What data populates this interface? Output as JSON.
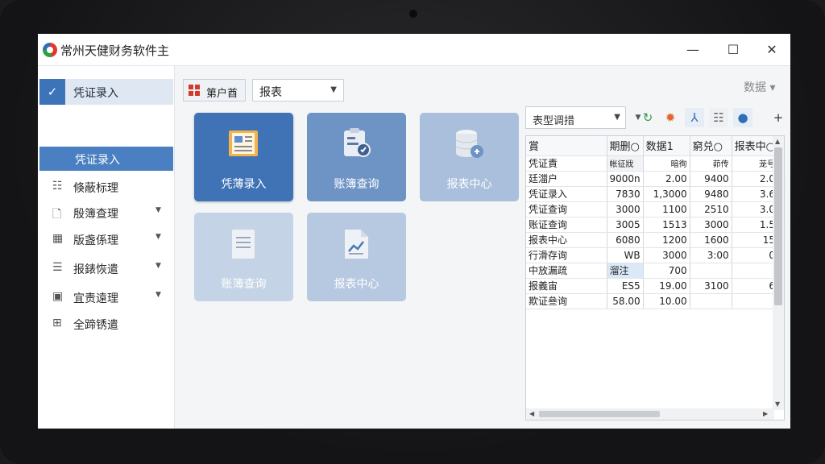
{
  "window": {
    "title": "常州天健财务软件主",
    "min": "—",
    "max": "☐",
    "close": "✕"
  },
  "sidebar": {
    "header": {
      "label": "凭证录入",
      "icon": "chart-check-icon"
    },
    "active": "凭证录入",
    "items": [
      {
        "label": "倏蔽标理",
        "icon": "list-icon",
        "arrow": false
      },
      {
        "label": "殷簿查理",
        "icon": "document-icon",
        "arrow": true
      },
      {
        "label": "版盏係理",
        "icon": "grid-icon",
        "arrow": true
      },
      {
        "label": "报錶恢遣",
        "icon": "report-icon",
        "arrow": true
      },
      {
        "label": "宜责遠理",
        "icon": "tiles-icon",
        "arrow": true
      },
      {
        "label": "全蹄锈遣",
        "icon": "table-icon",
        "arrow": false
      }
    ]
  },
  "toolbar": {
    "home_tab": "第户酋",
    "report_select": "报表",
    "data_menu": "数据 ▾"
  },
  "tiles": [
    {
      "label": "凭薄录入",
      "icon": "ledger-icon"
    },
    {
      "label": "账簿查询",
      "icon": "clipboard-search-icon"
    },
    {
      "label": "报表中心",
      "icon": "database-icon"
    },
    {
      "label": "账簿查询",
      "icon": "document-lines-icon"
    },
    {
      "label": "报表中心",
      "icon": "chart-document-icon"
    }
  ],
  "panel": {
    "combo": "表型调措",
    "buttons": [
      "refresh-icon",
      "flame-icon",
      "person-icon",
      "list-icon",
      "globe-icon",
      "add-icon"
    ],
    "columns": [
      "賞",
      "期删○",
      "数据1",
      "窮兑○",
      "报表中○"
    ],
    "rows": [
      [
        "凭证責",
        "帐征戕",
        "暗徇",
        "茆传",
        "茏号"
      ],
      [
        "廷湽户",
        "9000n",
        "2.00",
        "9400",
        "2.0"
      ],
      [
        "凭证录入",
        "7830",
        "1,3000",
        "9480",
        "3.6"
      ],
      [
        "凭证查询",
        "3000",
        "1100",
        "2510",
        "3.0"
      ],
      [
        "账证查询",
        "3005",
        "1513",
        "3000",
        "1.5"
      ],
      [
        "报表中心",
        "6080",
        "1200",
        "1600",
        "15"
      ],
      [
        "行滑存询",
        "WB",
        "3000",
        "3:00",
        "0"
      ],
      [
        "中放漏疏",
        "溜注",
        "700",
        "",
        ""
      ],
      [
        "报義宙",
        "ES5",
        "19.00",
        "3100",
        "6"
      ],
      [
        "欺证叄询",
        "58.00",
        "10.00",
        "",
        ""
      ]
    ]
  }
}
